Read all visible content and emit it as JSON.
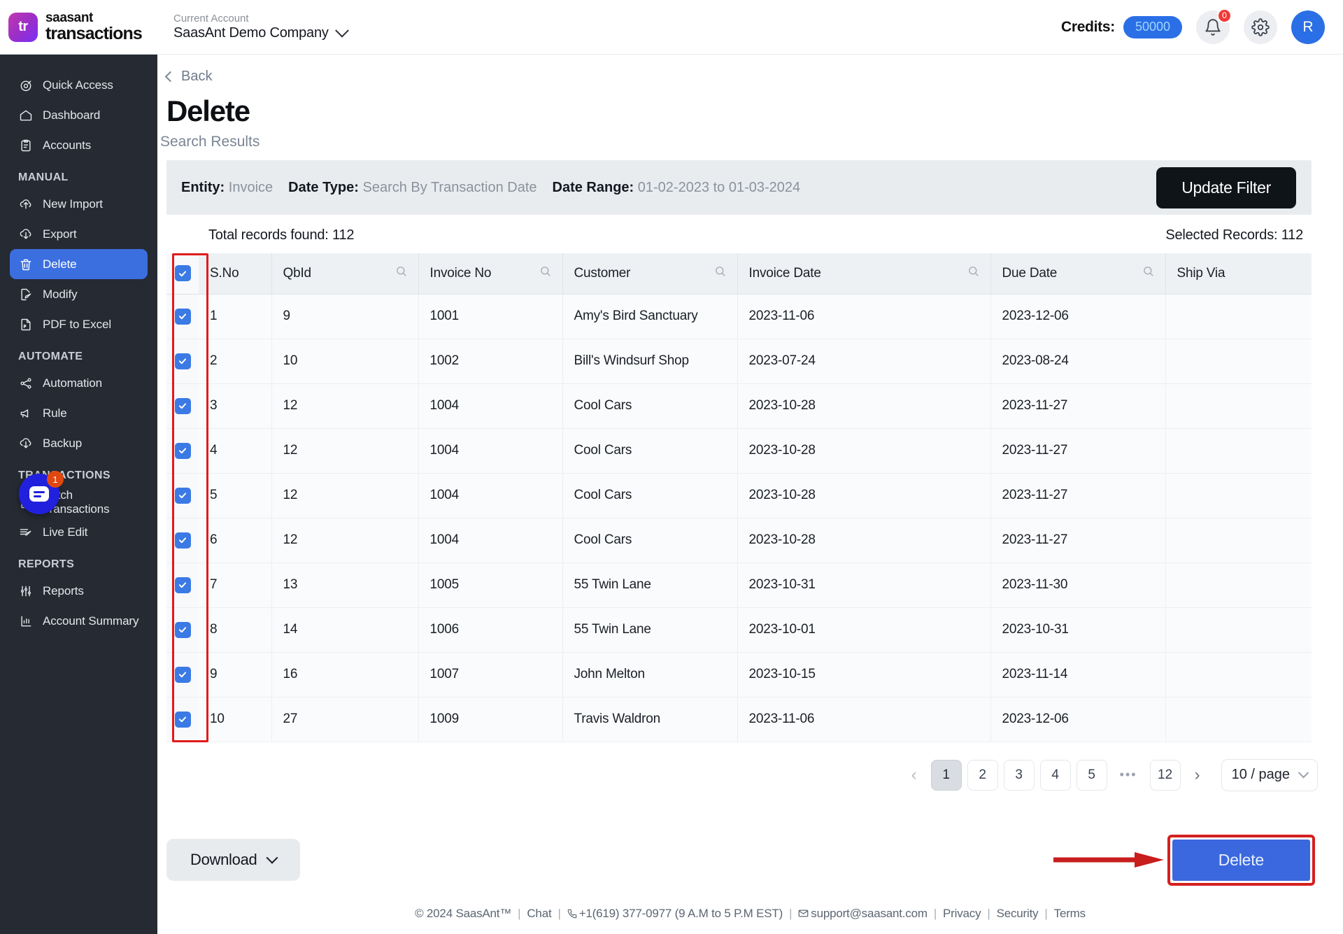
{
  "topbar": {
    "brand_mark": "tr",
    "brand_line1": "saasant",
    "brand_line2": "transactions",
    "account_label": "Current Account",
    "account_name": "SaasAnt Demo Company",
    "credits_label": "Credits:",
    "credits_value": "50000",
    "notification_badge": "0",
    "avatar_initial": "R",
    "accent_blue": "#2b6fe6",
    "badge_red": "#ef3b36"
  },
  "sidebar": {
    "items": [
      {
        "label": "Quick Access",
        "icon": "target-icon",
        "active": false
      },
      {
        "label": "Dashboard",
        "icon": "home-icon",
        "active": false
      },
      {
        "label": "Accounts",
        "icon": "clipboard-icon",
        "active": false
      }
    ],
    "groups": [
      {
        "title": "MANUAL",
        "items": [
          {
            "label": "New Import",
            "icon": "upload-cloud-icon",
            "active": false
          },
          {
            "label": "Export",
            "icon": "download-cloud-icon",
            "active": false
          },
          {
            "label": "Delete",
            "icon": "trash-icon",
            "active": true
          },
          {
            "label": "Modify",
            "icon": "file-edit-icon",
            "active": false
          },
          {
            "label": "PDF to Excel",
            "icon": "pdf-file-icon",
            "active": false
          }
        ]
      },
      {
        "title": "AUTOMATE",
        "items": [
          {
            "label": "Automation",
            "icon": "share-nodes-icon",
            "active": false
          },
          {
            "label": "Rule",
            "icon": "megaphone-icon",
            "active": false
          },
          {
            "label": "Backup",
            "icon": "download-cloud-icon",
            "active": false
          }
        ]
      },
      {
        "title": "TRANSACTIONS",
        "items": [
          {
            "label": "Batch Transactions",
            "icon": "document-icon",
            "active": false
          },
          {
            "label": "Live Edit",
            "icon": "live-edit-icon",
            "active": false
          }
        ]
      },
      {
        "title": "REPORTS",
        "items": [
          {
            "label": "Reports",
            "icon": "sliders-icon",
            "active": false
          },
          {
            "label": "Account Summary",
            "icon": "chart-icon",
            "active": false
          }
        ]
      }
    ],
    "chat_badge": "1"
  },
  "page": {
    "back_label": "Back",
    "title": "Delete",
    "subtitle": "Search Results"
  },
  "filter": {
    "entity_label": "Entity:",
    "entity_value": "Invoice",
    "date_type_label": "Date Type:",
    "date_type_value": "Search By Transaction Date",
    "date_range_label": "Date Range:",
    "date_range_value": "01-02-2023 to 01-03-2024",
    "update_button": "Update Filter"
  },
  "counts": {
    "total": "Total records found: 112",
    "selected": "Selected Records: 112"
  },
  "table": {
    "columns": [
      {
        "label": "S.No",
        "searchable": false
      },
      {
        "label": "QbId",
        "searchable": true
      },
      {
        "label": "Invoice No",
        "searchable": true
      },
      {
        "label": "Customer",
        "searchable": true
      },
      {
        "label": "Invoice Date",
        "searchable": true
      },
      {
        "label": "Due Date",
        "searchable": true
      },
      {
        "label": "Ship Via",
        "searchable": false
      }
    ],
    "rows": [
      {
        "checked": true,
        "sno": "1",
        "qbid": "9",
        "invoice_no": "1001",
        "customer": "Amy's Bird Sanctuary",
        "invoice_date": "2023-11-06",
        "due_date": "2023-12-06",
        "ship_via": ""
      },
      {
        "checked": true,
        "sno": "2",
        "qbid": "10",
        "invoice_no": "1002",
        "customer": "Bill's Windsurf Shop",
        "invoice_date": "2023-07-24",
        "due_date": "2023-08-24",
        "ship_via": ""
      },
      {
        "checked": true,
        "sno": "3",
        "qbid": "12",
        "invoice_no": "1004",
        "customer": "Cool Cars",
        "invoice_date": "2023-10-28",
        "due_date": "2023-11-27",
        "ship_via": ""
      },
      {
        "checked": true,
        "sno": "4",
        "qbid": "12",
        "invoice_no": "1004",
        "customer": "Cool Cars",
        "invoice_date": "2023-10-28",
        "due_date": "2023-11-27",
        "ship_via": ""
      },
      {
        "checked": true,
        "sno": "5",
        "qbid": "12",
        "invoice_no": "1004",
        "customer": "Cool Cars",
        "invoice_date": "2023-10-28",
        "due_date": "2023-11-27",
        "ship_via": ""
      },
      {
        "checked": true,
        "sno": "6",
        "qbid": "12",
        "invoice_no": "1004",
        "customer": "Cool Cars",
        "invoice_date": "2023-10-28",
        "due_date": "2023-11-27",
        "ship_via": ""
      },
      {
        "checked": true,
        "sno": "7",
        "qbid": "13",
        "invoice_no": "1005",
        "customer": "55 Twin Lane",
        "invoice_date": "2023-10-31",
        "due_date": "2023-11-30",
        "ship_via": ""
      },
      {
        "checked": true,
        "sno": "8",
        "qbid": "14",
        "invoice_no": "1006",
        "customer": "55 Twin Lane",
        "invoice_date": "2023-10-01",
        "due_date": "2023-10-31",
        "ship_via": ""
      },
      {
        "checked": true,
        "sno": "9",
        "qbid": "16",
        "invoice_no": "1007",
        "customer": "John Melton",
        "invoice_date": "2023-10-15",
        "due_date": "2023-11-14",
        "ship_via": ""
      },
      {
        "checked": true,
        "sno": "10",
        "qbid": "27",
        "invoice_no": "1009",
        "customer": "Travis Waldron",
        "invoice_date": "2023-11-06",
        "due_date": "2023-12-06",
        "ship_via": ""
      }
    ],
    "header_all_checked": true
  },
  "pagination": {
    "prev": "‹",
    "next": "›",
    "pages": [
      "1",
      "2",
      "3",
      "4",
      "5"
    ],
    "dots": "•••",
    "last": "12",
    "current": "1",
    "per_page": "10 / page"
  },
  "actions": {
    "download_label": "Download",
    "delete_label": "Delete",
    "delete_highlight_color": "#d32020",
    "delete_button_color": "#3b68de"
  },
  "footer": {
    "copyright": "© 2024 SaasAnt™",
    "chat": "Chat",
    "phone": "+1(619) 377-0977 (9 A.M to 5 P.M EST)",
    "email": "support@saasant.com",
    "privacy": "Privacy",
    "security": "Security",
    "terms": "Terms",
    "sep": "|"
  }
}
